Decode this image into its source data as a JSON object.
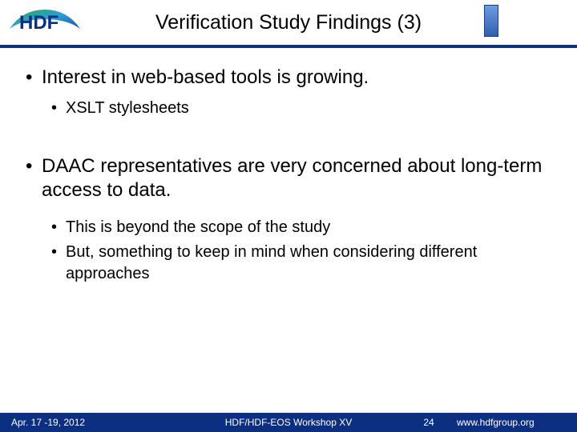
{
  "header": {
    "title": "Verification Study Findings (3)",
    "logo_text": "HDF"
  },
  "bullets": [
    {
      "text": "Interest in web-based tools is growing.",
      "sub": [
        "XSLT stylesheets"
      ]
    },
    {
      "text": "DAAC representatives are very concerned about long-term access to data.",
      "sub": [
        "This is beyond the scope of the study",
        "But, something to keep in mind when considering different approaches"
      ]
    }
  ],
  "footer": {
    "date": "Apr. 17 -19, 2012",
    "center": "HDF/HDF-EOS Workshop XV",
    "page": "24",
    "url": "www.hdfgroup.org"
  }
}
